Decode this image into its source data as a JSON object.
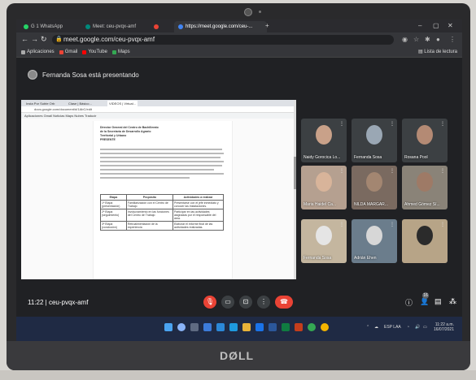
{
  "browser": {
    "tabs": [
      {
        "label": "G 1 WhatsApp",
        "color": "#25d366"
      },
      {
        "label": "Meet: ceu-pvqx-amf",
        "color": "#00897b"
      },
      {
        "label": "",
        "color": "#ea4335"
      },
      {
        "label": "https://meet.google.com/ceu-...",
        "color": "#4285f4"
      }
    ],
    "url": "meet.google.com/ceu-pvqx-amf",
    "bookmarks": [
      {
        "label": "Aplicaciones",
        "color": "#aaaaaa"
      },
      {
        "label": "Gmail",
        "color": "#ea4335"
      },
      {
        "label": "YouTube",
        "color": "#ff0000"
      },
      {
        "label": "Maps",
        "color": "#34a853"
      }
    ],
    "reading_list": "Lista de lectura"
  },
  "meet": {
    "presenting_text": "Fernanda Sosa está presentando",
    "meeting_code": "ceu-pvqx-amf",
    "time": "11:22",
    "participants_badge": "16",
    "participants": [
      {
        "name": "Naidy Gorocica Lo...",
        "bg": "#3c4043",
        "face": "#c9a189"
      },
      {
        "name": "Fernanda Sosa",
        "bg": "#3c4043",
        "face": "#9aa7b4"
      },
      {
        "name": "Rosana Pool",
        "bg": "#3c4043",
        "face": "#b48a74"
      },
      {
        "name": "Maria Haidel Ca...",
        "bg": "#b5a090",
        "face": "#d8b49a"
      },
      {
        "name": "NILDA MARGAR...",
        "bg": "#7a6a60",
        "face": "#a38671"
      },
      {
        "name": "Ahmed Gómez Sí...",
        "bg": "#8a8378",
        "face": "#9e7a66"
      },
      {
        "name": "Fernanda Sosa",
        "bg": "#c4b69f",
        "face": "#e5e5e5"
      },
      {
        "name": "Adrián Ehen",
        "bg": "#6b7d8c",
        "face": "#d7d7d7"
      },
      {
        "name": "",
        "bg": "#b7a487",
        "face": "#2b2b2b"
      }
    ]
  },
  "shared_doc": {
    "tabs": [
      "Insta Por Subte Orb",
      "Clase | Básico...",
      "VIDEOS | Virtual...",
      ""
    ],
    "url": "docs.google.com/document/d/1AbC/edit",
    "bookmarks": "Aplicaciones  Gmail  Noticias  Maps  Nubes  Traducir",
    "heading_lines": [
      "Director General del Centro de Bachillerato",
      "de la Secretaría de Desarrollo Agrario",
      "Territorial y Urbano",
      "PRESENTE"
    ],
    "table_header": [
      "Etapa",
      "Propósito",
      "Actividades a realizar"
    ],
    "table_rows": [
      [
        "1ª Etapa (presentación)",
        "Familiarización con el Centro de Trabajo",
        "Presentarse con el jefe inmediato y conocer las instalaciones."
      ],
      [
        "2ª Etapa (seguimiento)",
        "Involucramiento en las funciones del Centro de Trabajo",
        "Participar en las actividades asignadas por el responsable del área."
      ],
      [
        "3ª Etapa (conclusión)",
        "Retroalimentación de la experiencia",
        "Elaborar el informe final de las actividades realizadas."
      ]
    ]
  },
  "tray": {
    "lang": "ESP LAA",
    "time": "11:22 a.m.",
    "date": "16/07/2021"
  },
  "brand": "DØLL"
}
